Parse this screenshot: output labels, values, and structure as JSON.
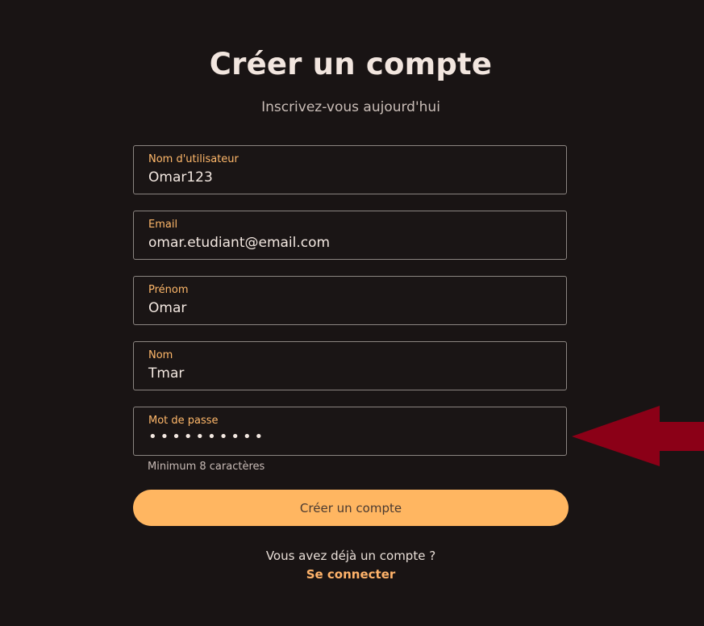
{
  "header": {
    "title": "Créer un compte",
    "subtitle": "Inscrivez-vous aujourd'hui"
  },
  "form": {
    "username": {
      "label": "Nom d'utilisateur",
      "value": "Omar123"
    },
    "email": {
      "label": "Email",
      "value": "omar.etudiant@email.com"
    },
    "first_name": {
      "label": "Prénom",
      "value": "Omar"
    },
    "last_name": {
      "label": "Nom",
      "value": "Tmar"
    },
    "password": {
      "label": "Mot de passe",
      "value": "••••••••••",
      "helper": "Minimum 8 caractères"
    },
    "submit_label": "Créer un compte"
  },
  "footer": {
    "account_text": "Vous avez déjà un compte ?",
    "login_link": "Se connecter"
  },
  "colors": {
    "background": "#191414",
    "accent": "#ffb661",
    "arrow": "#8b0017"
  }
}
